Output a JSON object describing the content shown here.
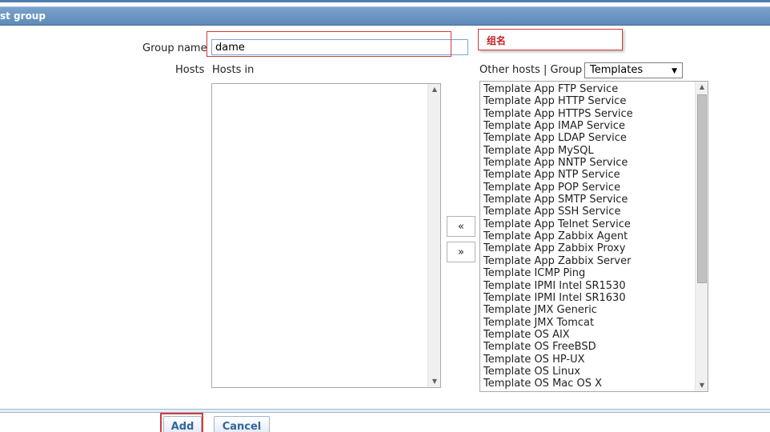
{
  "header": {
    "title": "st group"
  },
  "form": {
    "group_name_label": "Group name",
    "group_name_value": "dame",
    "hosts_label": "Hosts",
    "hosts_in_label": "Hosts in",
    "hosts_in": [],
    "other_hosts_label": "Other hosts | Group",
    "group_select": {
      "selected": "Templates"
    },
    "other_hosts": [
      "Template App FTP Service",
      "Template App HTTP Service",
      "Template App HTTPS Service",
      "Template App IMAP Service",
      "Template App LDAP Service",
      "Template App MySQL",
      "Template App NNTP Service",
      "Template App NTP Service",
      "Template App POP Service",
      "Template App SMTP Service",
      "Template App SSH Service",
      "Template App Telnet Service",
      "Template App Zabbix Agent",
      "Template App Zabbix Proxy",
      "Template App Zabbix Server",
      "Template ICMP Ping",
      "Template IPMI Intel SR1530",
      "Template IPMI Intel SR1630",
      "Template JMX Generic",
      "Template JMX Tomcat",
      "Template OS AIX",
      "Template OS FreeBSD",
      "Template OS HP-UX",
      "Template OS Linux",
      "Template OS Mac OS X"
    ],
    "move_left_label": "«",
    "move_right_label": "»"
  },
  "annotation": {
    "text": "组名",
    "color": "#c21f1f"
  },
  "icons": {
    "scroll_up": "scroll-up-icon",
    "scroll_down": "scroll-down-icon",
    "dropdown_arrow": "chevron-down-icon"
  },
  "buttons": {
    "add_label": "Add",
    "cancel_label": "Cancel"
  },
  "colors": {
    "header": "#5d8ab8",
    "button_text": "#33669a",
    "highlight": "#d23b3b"
  }
}
